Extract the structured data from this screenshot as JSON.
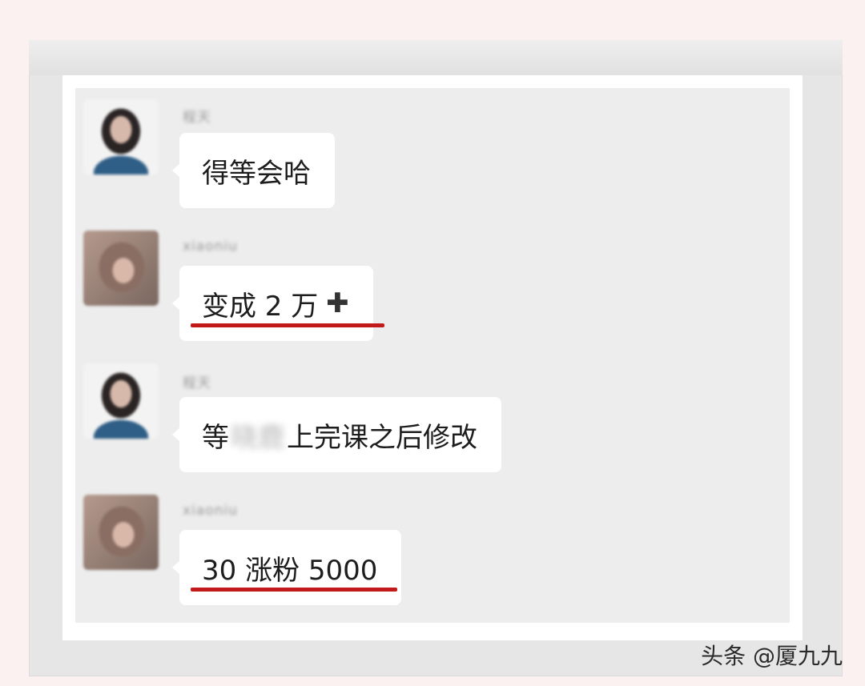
{
  "messages": [
    {
      "sender": "程天",
      "text": "得等会哈",
      "avatar": "woman-portrait-avatar"
    },
    {
      "sender": "xiaoniu",
      "text": "变成 2 万",
      "suffix": "✚",
      "avatar": "blurred-portrait-avatar",
      "underlined": true
    },
    {
      "sender": "程天",
      "text_before": "等",
      "blurred_name": "晓鹿",
      "text_after": "上完课之后修改",
      "avatar": "woman-portrait-avatar"
    },
    {
      "sender": "xiaoniu",
      "text": "30 涨粉 5000",
      "avatar": "blurred-portrait-avatar",
      "underlined": true
    }
  ],
  "watermark": "头条 @厦九九",
  "colors": {
    "chat_background": "#ededed",
    "bubble": "#ffffff",
    "underline": "#c21a1a",
    "page_background": "#fbf1f1"
  }
}
